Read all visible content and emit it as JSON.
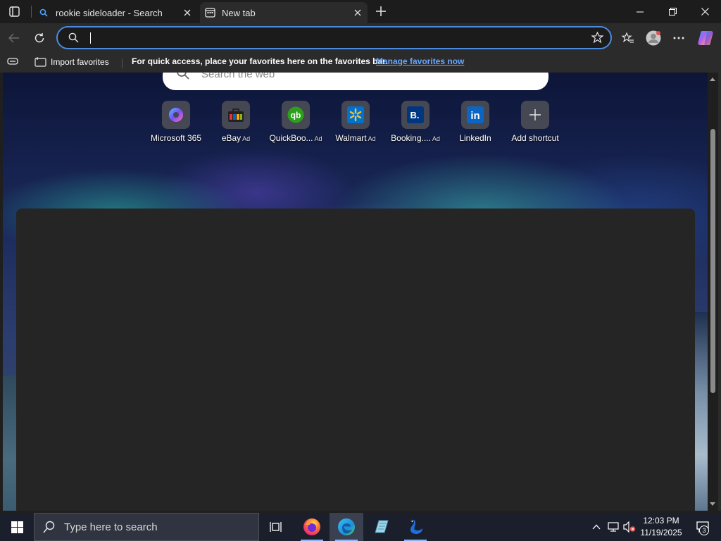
{
  "tabs": [
    {
      "title": "rookie sideloader - Search",
      "active": false
    },
    {
      "title": "New tab",
      "active": true
    }
  ],
  "address_bar": {
    "value": "",
    "placeholder": ""
  },
  "favorites_bar": {
    "import_label": "Import favorites",
    "message": "For quick access, place your favorites here on the favorites bar.",
    "manage_link": "Manage favorites now"
  },
  "new_tab": {
    "search_placeholder": "Search the web",
    "shortcuts": [
      {
        "label": "Microsoft 365",
        "ad": ""
      },
      {
        "label": "eBay",
        "ad": "Ad"
      },
      {
        "label": "QuickBoo...",
        "ad": "Ad"
      },
      {
        "label": "Walmart",
        "ad": "Ad"
      },
      {
        "label": "Booking....",
        "ad": "Ad"
      },
      {
        "label": "LinkedIn",
        "ad": ""
      },
      {
        "label": "Add shortcut",
        "ad": ""
      }
    ]
  },
  "taskbar": {
    "search_placeholder": "Type here to search",
    "time": "12:03 PM",
    "date": "11/19/2025",
    "notification_count": "3"
  },
  "colors": {
    "accent": "#4b8ce0",
    "link": "#6aa7ff",
    "taskbar": "#1a1f2b"
  }
}
